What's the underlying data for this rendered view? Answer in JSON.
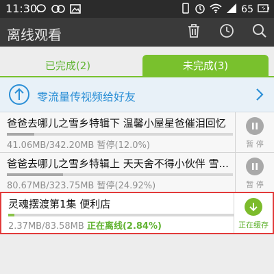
{
  "status_bar": {
    "time": "11:30",
    "battery": "65",
    "colors": {
      "bg": "#2b2b2b"
    }
  },
  "app_bar": {
    "title": "离线观看",
    "icons": [
      "trash-icon",
      "clock-icon",
      "search-icon"
    ]
  },
  "tabs": [
    {
      "label": "已完成(2)",
      "selected": false
    },
    {
      "label": "未完成(3)",
      "selected": true
    }
  ],
  "share_banner": {
    "text": "零流量传视频给好友"
  },
  "downloads": [
    {
      "title": "爸爸去哪儿之雪乡特辑下 温馨小屋星爸催泪回忆",
      "size": "41.06MB/342.20MB",
      "status": "暂停(12.0%)",
      "progress": 0.12,
      "action_label": "暂 停",
      "action_icon": "pause-icon"
    },
    {
      "title": "爸爸去哪儿之雪乡特辑上 天天舍不得小伙伴 雪...",
      "size": "80.67MB/323.75MB",
      "status": "暂停(24.92%)",
      "progress": 0.2492,
      "action_label": "暂 停",
      "action_icon": "pause-icon"
    },
    {
      "title": "灵魂摆渡第1集 便利店",
      "size": "2.37MB/83.58MB",
      "status": "正在离线(2.84%)",
      "progress": 0.0284,
      "action_label": "正在缓存",
      "action_icon": "download-arrow-icon"
    }
  ],
  "colors": {
    "accent_green": "#79c12d",
    "link_blue": "#2b8fd6",
    "highlight_red": "#e23a3a"
  }
}
